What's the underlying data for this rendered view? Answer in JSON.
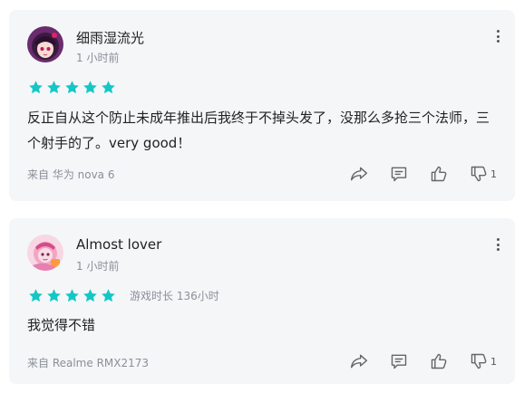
{
  "colors": {
    "star": "#14c7c7",
    "card_bg": "#f5f6f8",
    "muted_text": "#8a8f98",
    "icon": "#666666"
  },
  "reviews": [
    {
      "username": "细雨湿流光",
      "time": "1 小时前",
      "rating": 5,
      "playtime": "",
      "text": "反正自从这个防止未成年推出后我终于不掉头发了，没那么多抢三个法师，三个射手的了。very good！",
      "device": "来自 华为 nova 6",
      "dislike_count": "1",
      "avatar_icon": "anime-girl-avatar-icon"
    },
    {
      "username": "Almost lover",
      "time": "1 小时前",
      "rating": 5,
      "playtime": "游戏时长 136小时",
      "text": "我觉得不错",
      "device": "来自 Realme RMX2173",
      "dislike_count": "1",
      "avatar_icon": "pink-cartoon-avatar-icon"
    }
  ],
  "icons": {
    "more": "more-vertical-icon",
    "share": "share-icon",
    "reply": "comment-icon",
    "like": "thumbs-up-icon",
    "dislike": "thumbs-down-icon",
    "star": "star-icon"
  }
}
